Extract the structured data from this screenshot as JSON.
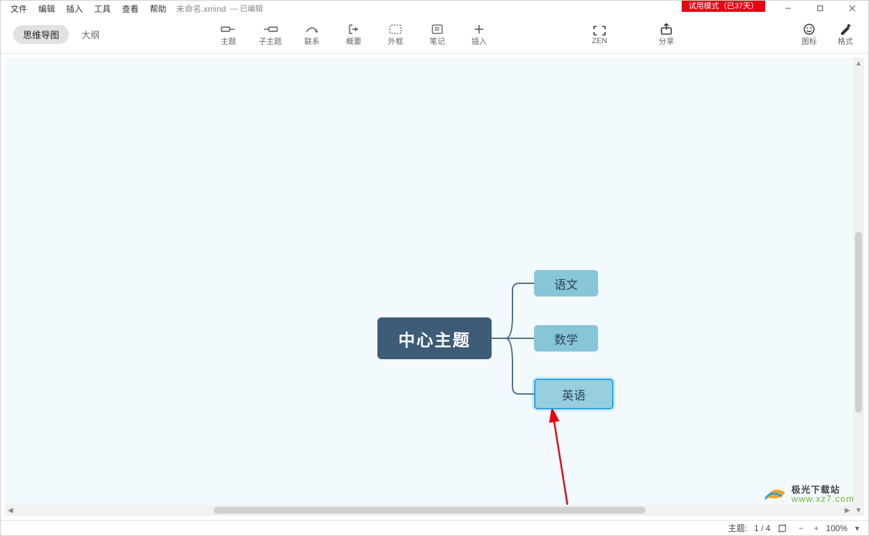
{
  "menu": {
    "items": [
      "文件",
      "编辑",
      "插入",
      "工具",
      "查看",
      "帮助"
    ],
    "doc_title": "未命名.xmind",
    "edited": "— 已编辑"
  },
  "trial_badge": "试用模式（已37天）",
  "window_controls": {
    "minimize": "minimize",
    "maximize": "maximize",
    "close": "close"
  },
  "view_tabs": {
    "mindmap": "思维导图",
    "outline": "大纲"
  },
  "toolbar": {
    "topic": "主题",
    "subtopic": "子主题",
    "relationship": "联系",
    "summary": "概要",
    "boundary": "外框",
    "note": "笔记",
    "insert": "插入",
    "zen": "ZEN",
    "share": "分享",
    "icons": "图标",
    "format": "格式"
  },
  "mindmap": {
    "central": "中心主题",
    "branches": [
      "语文",
      "数学",
      "英语"
    ],
    "selected_index": 2
  },
  "statusbar": {
    "label": "主题:",
    "count": "1 / 4",
    "zoom": "100%"
  },
  "watermark": {
    "brand": "极光下载站",
    "url": "www.xz7.com"
  }
}
